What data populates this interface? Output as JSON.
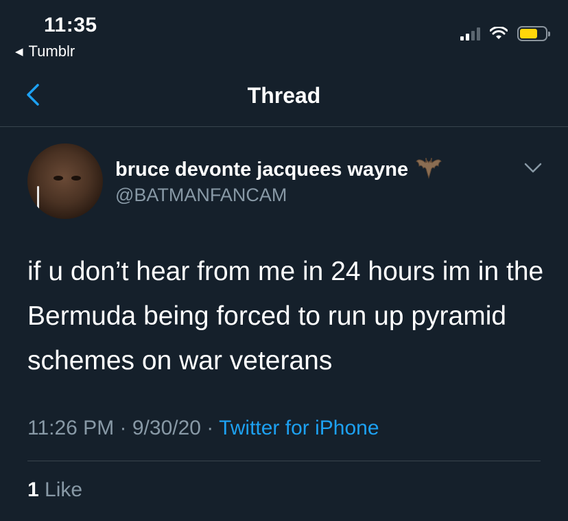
{
  "status_bar": {
    "time": "11:35",
    "back_app": "Tumblr",
    "back_arrow": "◀",
    "battery_color": "#ffd60a"
  },
  "nav": {
    "title": "Thread",
    "back_icon": "chevron-left-icon",
    "accent_color": "#1da1f2"
  },
  "tweet": {
    "display_name": "bruce devonte jacquees wayne",
    "name_emoji": "🦇",
    "handle": "@BATMANFANCAM",
    "text": "if u don’t hear from me in 24 hours im in the Bermuda being forced to run up pyramid schemes on war veterans",
    "time": "11:26 PM",
    "sep1": " · ",
    "date": "9/30/20",
    "sep2": " · ",
    "source": "Twitter for iPhone",
    "like_count": "1",
    "like_label": "Like"
  }
}
